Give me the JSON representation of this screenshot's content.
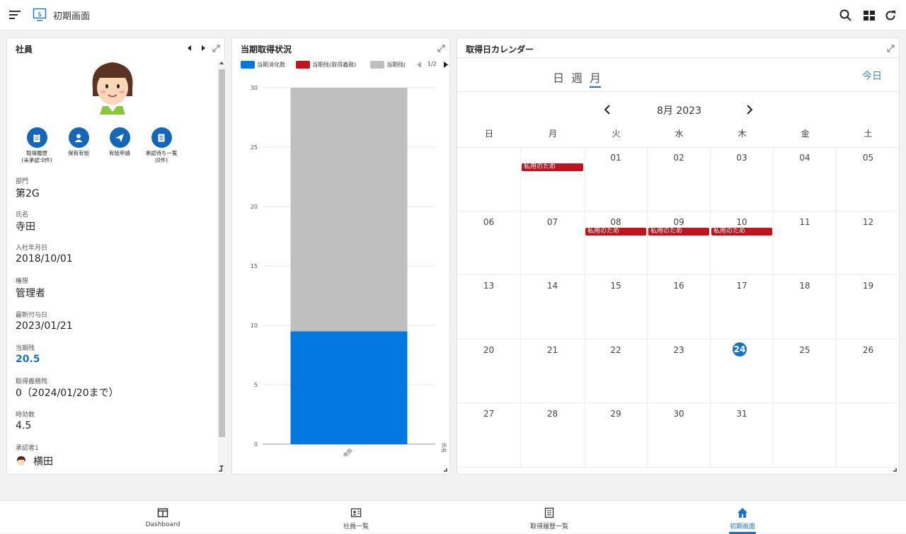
{
  "header": {
    "title": "初期画面"
  },
  "employee_panel": {
    "title": "社員",
    "actions": [
      {
        "label": "取得履歴\n(未承認:0件)",
        "icon": "clipboard-icon"
      },
      {
        "label": "保有有給",
        "icon": "user-icon"
      },
      {
        "label": "有給申請",
        "icon": "send-icon"
      },
      {
        "label": "承認待ち一覧\n(0件)",
        "icon": "list-icon"
      }
    ],
    "fields": [
      {
        "label": "部門",
        "value": "第2G"
      },
      {
        "label": "氏名",
        "value": "寺田"
      },
      {
        "label": "入社年月日",
        "value": "2018/10/01"
      },
      {
        "label": "権限",
        "value": "管理者"
      },
      {
        "label": "最新付与日",
        "value": "2023/01/21"
      },
      {
        "label": "当期残",
        "value": "20.5"
      },
      {
        "label": "取得義務残",
        "value": "0（2024/01/20まで）"
      },
      {
        "label": "時効数",
        "value": "4.5"
      },
      {
        "label": "承認者1",
        "value": "横田"
      }
    ]
  },
  "chart_panel": {
    "title": "当期取得状況",
    "legend_page": "1/2",
    "colors": {
      "used": "#0078e0",
      "mandatory": "#c1121d",
      "remaining": "#bfbfbf"
    }
  },
  "chart_data": {
    "type": "bar",
    "stacked": true,
    "categories": [
      "寺田"
    ],
    "series": [
      {
        "name": "当期消化数",
        "values": [
          9.5
        ]
      },
      {
        "name": "当期残(取得義務)",
        "values": [
          0
        ]
      },
      {
        "name": "当期残(",
        "values": [
          20.5
        ]
      }
    ],
    "xlabel": "氏名",
    "ylabel": "",
    "ylim": [
      0,
      30
    ],
    "yticks": [
      0,
      5,
      10,
      15,
      20,
      25,
      30
    ],
    "grid": true,
    "legend": "top"
  },
  "calendar": {
    "title": "取得日カレンダー",
    "tabs": [
      "日",
      "週",
      "月"
    ],
    "active_tab": "月",
    "today_label": "今日",
    "month_label": "8月 2023",
    "weekdays": [
      "日",
      "月",
      "火",
      "水",
      "木",
      "金",
      "土"
    ],
    "weeks": [
      [
        "",
        "",
        "01",
        "02",
        "03",
        "04",
        "05"
      ],
      [
        "06",
        "07",
        "08",
        "09",
        "10",
        "11",
        "12"
      ],
      [
        "13",
        "14",
        "15",
        "16",
        "17",
        "18",
        "19"
      ],
      [
        "20",
        "21",
        "22",
        "23",
        "24",
        "25",
        "26"
      ],
      [
        "27",
        "28",
        "29",
        "30",
        "31",
        "",
        ""
      ]
    ],
    "today": "24",
    "events": [
      {
        "date": "07-31",
        "week": 0,
        "day": 1,
        "label": "私用のため"
      },
      {
        "date": "08-08",
        "week": 1,
        "day": 2,
        "label": "私用のため"
      },
      {
        "date": "08-09",
        "week": 1,
        "day": 3,
        "label": "私用のため"
      },
      {
        "date": "08-10",
        "week": 1,
        "day": 4,
        "label": "私用のため"
      }
    ]
  },
  "bottom_nav": [
    {
      "label": "Dashboard",
      "icon": "dashboard-icon",
      "active": false
    },
    {
      "label": "社員一覧",
      "icon": "id-card-icon",
      "active": false
    },
    {
      "label": "取得履歴一覧",
      "icon": "list-doc-icon",
      "active": false
    },
    {
      "label": "初期画面",
      "icon": "home-icon",
      "active": true
    }
  ]
}
